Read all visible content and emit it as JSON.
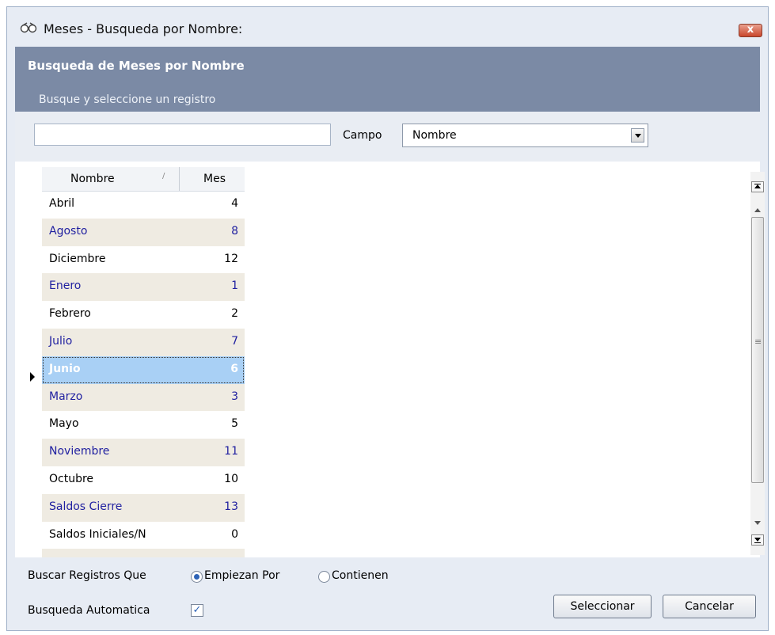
{
  "window": {
    "title": "Meses - Busqueda por Nombre:",
    "close_label": "x"
  },
  "header": {
    "title": "Busqueda de Meses por Nombre",
    "subtitle": "Busque y seleccione un registro"
  },
  "search": {
    "value": "",
    "campo_label": "Campo",
    "campo_value": "Nombre"
  },
  "grid": {
    "columns": [
      "Nombre",
      "Mes"
    ],
    "sort_glyph": "/",
    "selected_row": "Junio",
    "rows": [
      {
        "nombre": "Abril",
        "mes": "4"
      },
      {
        "nombre": "Agosto",
        "mes": "8"
      },
      {
        "nombre": "Diciembre",
        "mes": "12"
      },
      {
        "nombre": "Enero",
        "mes": "1"
      },
      {
        "nombre": "Febrero",
        "mes": "2"
      },
      {
        "nombre": "Julio",
        "mes": "7"
      },
      {
        "nombre": "Junio",
        "mes": "6"
      },
      {
        "nombre": "Marzo",
        "mes": "3"
      },
      {
        "nombre": "Mayo",
        "mes": "5"
      },
      {
        "nombre": "Noviembre",
        "mes": "11"
      },
      {
        "nombre": "Octubre",
        "mes": "10"
      },
      {
        "nombre": "Saldos Cierre",
        "mes": "13"
      },
      {
        "nombre": "Saldos Iniciales/N",
        "mes": "0"
      }
    ]
  },
  "footer": {
    "buscar_label": "Buscar Registros Que",
    "option_empiezan": "Empiezan Por",
    "option_contienen": "Contienen",
    "selected_option": "Empiezan Por",
    "automatica_label": "Busqueda Automatica",
    "automatica_checked": true,
    "select_button": "Seleccionar",
    "cancel_button": "Cancelar"
  },
  "icons": {
    "window_icon": "binoculars-icon"
  },
  "colors": {
    "header_bg": "#7b8aa5",
    "alt_row_bg": "#efebe2",
    "alt_row_text": "#1f1fa0",
    "selected_row_bg": "#a9d0f5"
  }
}
